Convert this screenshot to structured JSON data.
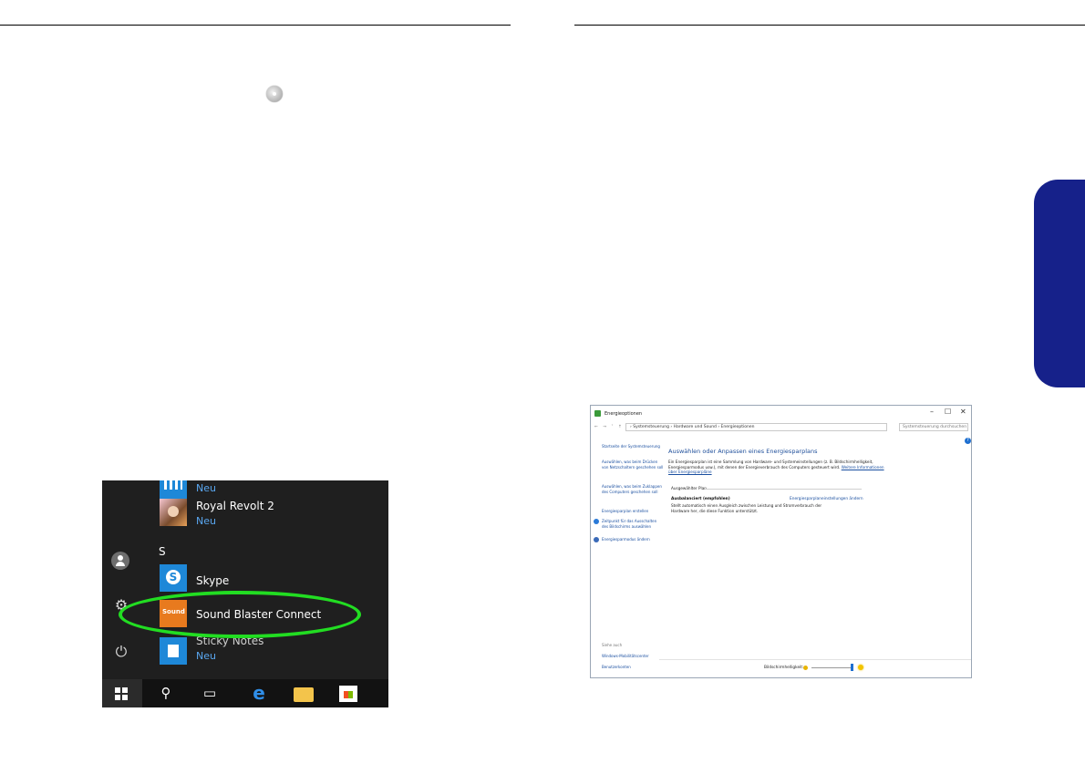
{
  "start_menu": {
    "top_app_sub": "Neu",
    "royal": {
      "name": "Royal Revolt 2",
      "sub": "Neu"
    },
    "section_letter": "S",
    "skype": {
      "name": "Skype"
    },
    "sound_blaster": {
      "name": "Sound Blaster Connect"
    },
    "sticky": {
      "name": "Sticky Notes",
      "sub": "Neu"
    }
  },
  "energy_window": {
    "title": "Energieoptionen",
    "controls": {
      "minimize": "–",
      "maximize": "☐",
      "close": "✕"
    },
    "nav_buttons": "← → ˅ ↑",
    "breadcrumb": "› Systemsteuerung › Hardware und Sound › Energieoptionen",
    "search_placeholder": "Systemsteuerung durchsuchen",
    "help": "?",
    "left_nav": {
      "home": "Startseite der Systemsteuerung",
      "power_buttons": "Auswählen, was beim Drücken von Netzschaltern geschehen soll",
      "lid": "Auswählen, was beim Zuklappen des Computers geschehen soll",
      "create_plan": "Energiesparplan erstellen",
      "display_off": "Zeitpunkt für das Ausschalten des Bildschirms auswählen",
      "sleep": "Energiesparmodus ändern"
    },
    "heading": "Auswählen oder Anpassen eines Energiesparplans",
    "description": "Ein Energiesparplan ist eine Sammlung von Hardware- und Systemeinstellungen (z. B. Bildschirmhelligkeit, Energiesparmodus usw.), mit denen der Energieverbrauch des Computers gesteuert wird.",
    "more_info_link": "Weitere Informationen über Energiesparpläne",
    "selected_plan_label": "Ausgewählter Plan",
    "plan_name": "Ausbalanciert (empfohlen)",
    "plan_settings_link": "Energiesparplaneinstellungen ändern",
    "plan_description": "Stellt automatisch einen Ausgleich zwischen Leistung und Stromverbrauch der Hardware her, die diese Funktion unterstützt.",
    "see_also": "Siehe auch",
    "mobility_center": "Windows-Mobilitätscenter",
    "user_accounts": "Benutzerkonten",
    "brightness_label": "Bildschirmhelligkeit:",
    "brightness_level": 0.95
  }
}
